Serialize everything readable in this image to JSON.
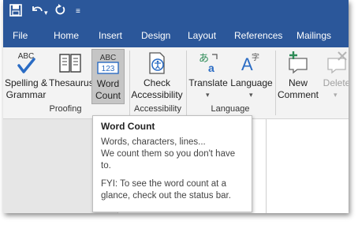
{
  "quick_access": {
    "save_icon": "save-icon",
    "undo_icon": "undo-icon",
    "redo_icon": "redo-icon",
    "customize_icon": "customize-qat-icon"
  },
  "tabs": [
    "File",
    "Home",
    "Insert",
    "Design",
    "Layout",
    "References",
    "Mailings"
  ],
  "ribbon": {
    "proofing": {
      "group_label": "Proofing",
      "spelling": {
        "line1": "Spelling &",
        "line2": "Grammar",
        "icon_text": "ABC"
      },
      "thesaurus": {
        "label": "Thesaurus"
      },
      "word_count": {
        "line1": "Word",
        "line2": "Count",
        "icon_top": "ABC",
        "icon_bottom": "123"
      }
    },
    "accessibility": {
      "group_label": "Accessibility",
      "check": {
        "line1": "Check",
        "line2": "Accessibility"
      }
    },
    "language": {
      "group_label": "Language",
      "translate": {
        "label": "Translate"
      },
      "language": {
        "label": "Language"
      }
    },
    "comments": {
      "new_comment": {
        "line1": "New",
        "line2": "Comment"
      },
      "delete": {
        "label": "Delete"
      }
    }
  },
  "tooltip": {
    "title": "Word Count",
    "line1": "Words, characters, lines...",
    "line2": "We count them so you don't have",
    "line3": "to.",
    "line4": "FYI: To see the word count at a",
    "line5": "glance, check out the status bar."
  },
  "colors": {
    "ribbon_blue": "#2b579a",
    "accent_green": "#2e8b57",
    "spell_blue": "#2b6cc4"
  }
}
